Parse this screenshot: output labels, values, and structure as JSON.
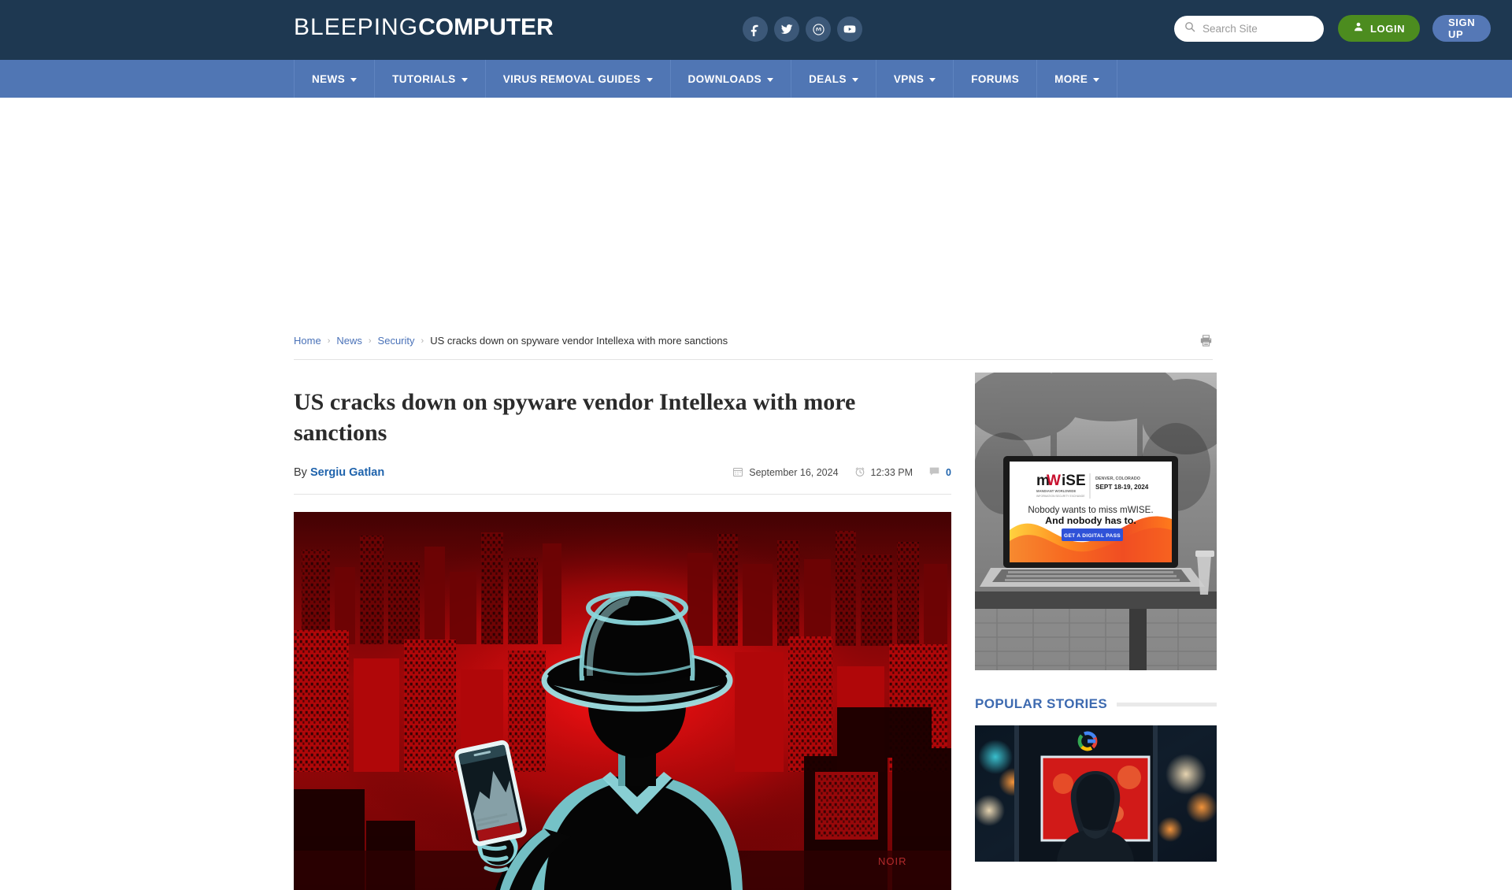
{
  "site": {
    "logo_thin": "BLEEPING",
    "logo_bold": "COMPUTER"
  },
  "header": {
    "social": [
      {
        "name": "facebook",
        "label": "Facebook"
      },
      {
        "name": "twitter",
        "label": "Twitter"
      },
      {
        "name": "mastodon",
        "label": "Mastodon"
      },
      {
        "name": "youtube",
        "label": "YouTube"
      }
    ],
    "search": {
      "placeholder": "Search Site",
      "value": "",
      "icon": "search-icon"
    },
    "login_label": "LOGIN",
    "signup_label": "SIGN UP",
    "login_color": "#4c8c1f",
    "signup_color": "#5578b6"
  },
  "nav": {
    "items": [
      {
        "label": "NEWS",
        "has_dropdown": true
      },
      {
        "label": "TUTORIALS",
        "has_dropdown": true
      },
      {
        "label": "VIRUS REMOVAL GUIDES",
        "has_dropdown": true
      },
      {
        "label": "DOWNLOADS",
        "has_dropdown": true
      },
      {
        "label": "DEALS",
        "has_dropdown": true
      },
      {
        "label": "VPNS",
        "has_dropdown": true
      },
      {
        "label": "FORUMS",
        "has_dropdown": false
      },
      {
        "label": "MORE",
        "has_dropdown": true
      }
    ]
  },
  "breadcrumb": {
    "items": [
      {
        "label": "Home",
        "link": true
      },
      {
        "label": "News",
        "link": true
      },
      {
        "label": "Security",
        "link": true
      },
      {
        "label": "US cracks down on spyware vendor Intellexa with more sanctions",
        "link": false
      }
    ],
    "separator": "›",
    "print_icon": "printer-icon"
  },
  "article": {
    "title": "US cracks down on spyware vendor Intellexa with more sanctions",
    "by_prefix": "By",
    "author": "Sergiu Gatlan",
    "date": "September 16, 2024",
    "time": "12:33 PM",
    "comment_count": "0",
    "hero_alt": "Illustration of a silhouetted spy in a fedora hat holding a smartphone, over a red city skyline"
  },
  "sidebar": {
    "ad": {
      "brand": "mWISE",
      "brand_sub_line1": "MANDIANT WORLDWIDE",
      "brand_sub_line2": "INFORMATION SECURITY EXCHANGE",
      "location": "DENVER, COLORADO",
      "dates": "SEPT 18-19, 2024",
      "headline_line1": "Nobody wants to miss mWISE.",
      "headline_line2": "And nobody has to.",
      "cta": "GET A DIGITAL PASS",
      "cta_color": "#2f52d8"
    },
    "popular": {
      "title": "POPULAR STORIES",
      "title_color": "#3d6ab0",
      "thumb_alt": "Hooded figure in front of a red lit screen with a Google logo above"
    }
  },
  "colors": {
    "header_bg": "#1e3851",
    "nav_bg": "#5076b4",
    "link_blue": "#4a72b8",
    "author_blue": "#1f63ac"
  }
}
